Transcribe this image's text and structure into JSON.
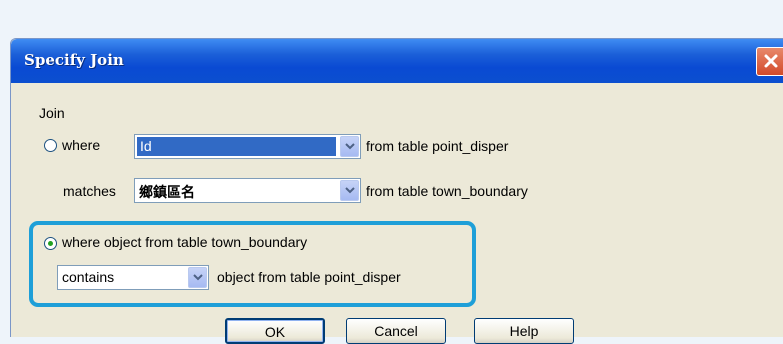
{
  "window": {
    "title": "Specify Join"
  },
  "join": {
    "group_label": "Join",
    "where_radio_label": "where",
    "where_field": {
      "selected": "Id",
      "suffix": "from table point_disper"
    },
    "matches_label": "matches",
    "matches_field": {
      "selected": "鄉鎮區名",
      "suffix": "from table town_boundary"
    },
    "object_radio_label": "where object from table town_boundary",
    "relation_field": {
      "selected": "contains",
      "suffix": "object from table point_disper"
    }
  },
  "buttons": {
    "ok": "OK",
    "cancel": "Cancel",
    "help": "Help"
  },
  "colors": {
    "highlight": "#1e9fd8",
    "titlebar": "#0a4ad3",
    "selection": "#316ac5"
  }
}
